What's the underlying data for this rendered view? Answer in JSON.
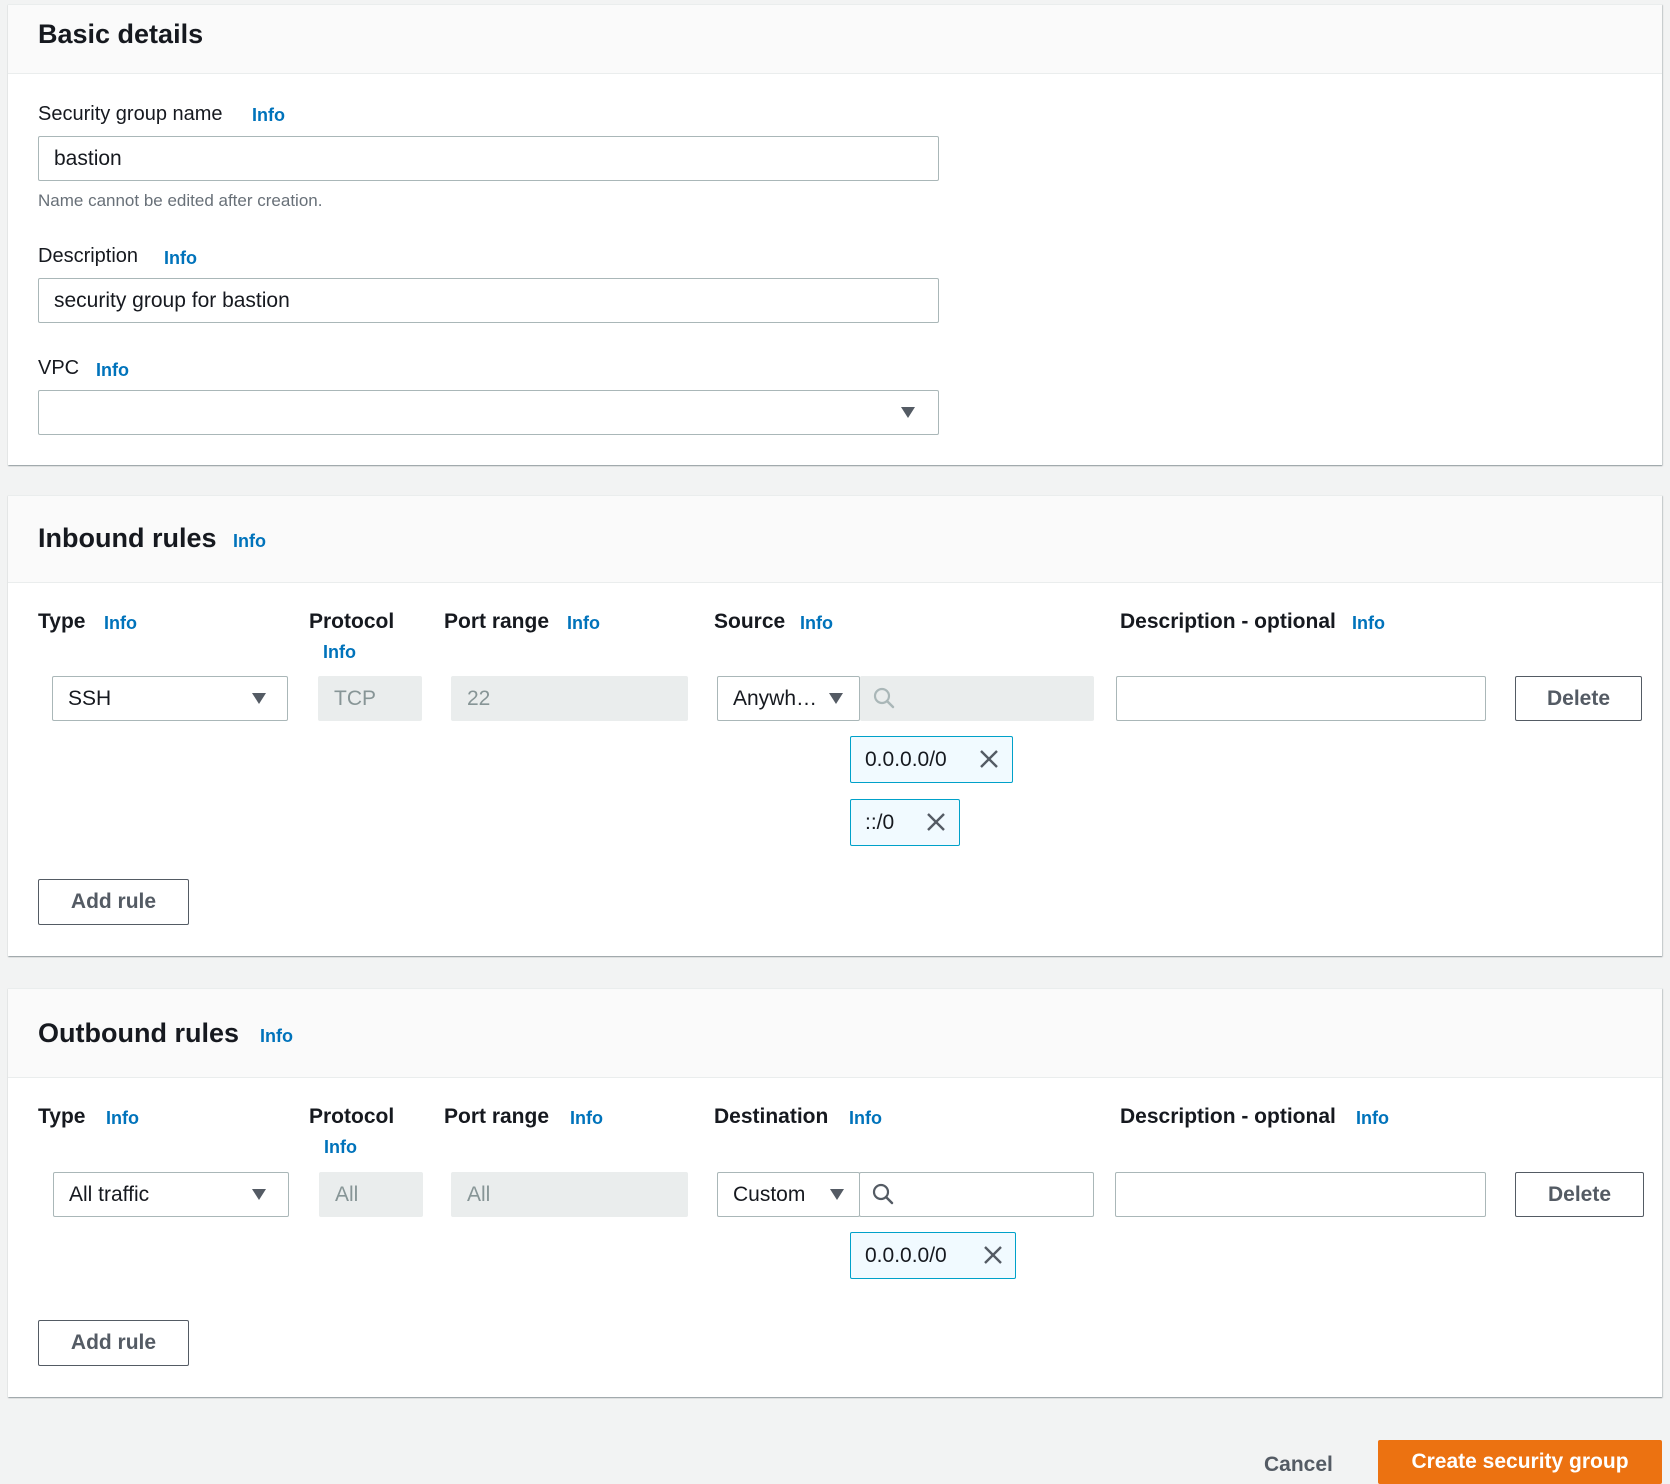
{
  "basic": {
    "title": "Basic details",
    "name_label": "Security group name",
    "name_info": "Info",
    "name_value": "bastion",
    "name_hint": "Name cannot be edited after creation.",
    "desc_label": "Description",
    "desc_info": "Info",
    "desc_value": "security group for bastion",
    "vpc_label": "VPC",
    "vpc_info": "Info",
    "vpc_value": ""
  },
  "inbound": {
    "title": "Inbound rules",
    "info": "Info",
    "columns": {
      "type": "Type",
      "type_info": "Info",
      "protocol": "Protocol",
      "protocol_info": "Info",
      "port": "Port range",
      "port_info": "Info",
      "source": "Source",
      "source_info": "Info",
      "desc": "Description - optional",
      "desc_info": "Info"
    },
    "rule": {
      "type": "SSH",
      "protocol": "TCP",
      "port": "22",
      "source_mode": "Anywh…",
      "source_search": "",
      "tokens": [
        "0.0.0.0/0",
        "::/0"
      ],
      "description": "",
      "delete_label": "Delete"
    },
    "add_rule_label": "Add rule"
  },
  "outbound": {
    "title": "Outbound rules",
    "info": "Info",
    "columns": {
      "type": "Type",
      "type_info": "Info",
      "protocol": "Protocol",
      "protocol_info": "Info",
      "port": "Port range",
      "port_info": "Info",
      "destination": "Destination",
      "destination_info": "Info",
      "desc": "Description - optional",
      "desc_info": "Info"
    },
    "rule": {
      "type": "All traffic",
      "protocol": "All",
      "port": "All",
      "dest_mode": "Custom",
      "dest_search": "",
      "tokens": [
        "0.0.0.0/0"
      ],
      "description": "",
      "delete_label": "Delete"
    },
    "add_rule_label": "Add rule"
  },
  "footer": {
    "cancel_label": "Cancel",
    "create_label": "Create security group"
  },
  "colors": {
    "info_link": "#0073bb",
    "primary": "#ec7211",
    "token_border": "#00a1c9",
    "token_bg": "#f1faff"
  }
}
